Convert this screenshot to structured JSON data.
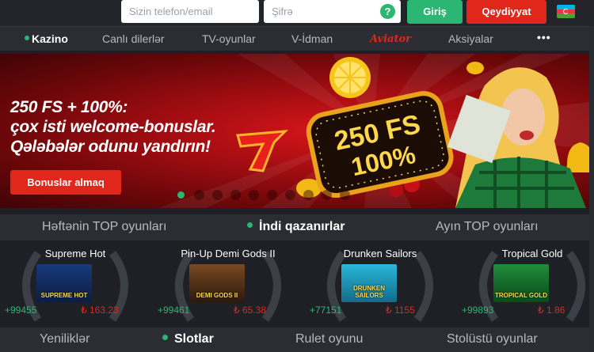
{
  "auth": {
    "phone_placeholder": "Sizin telefon/email",
    "password_placeholder": "Şifrə",
    "help_label": "?",
    "login_label": "Giriş",
    "register_label": "Qeydiyyat",
    "language_flag": "az-flag"
  },
  "nav": {
    "items": [
      {
        "label": "Kazino",
        "active": true
      },
      {
        "label": "Canlı dilerlər"
      },
      {
        "label": "TV-oyunlar"
      },
      {
        "label": "V-İdman"
      },
      {
        "label": "Aviator"
      },
      {
        "label": "Aksiyalar"
      },
      {
        "label": "•••"
      }
    ]
  },
  "banner": {
    "line1": "250 FS + 100%:",
    "line2": "çox isti welcome-bonuslar.",
    "line3": "Qələbələr odunu yandırın!",
    "cta": "Bonuslar almaq",
    "sign_line1": "250 FS",
    "sign_line2": "100%",
    "slides": 10,
    "active_slide": 1
  },
  "winner_tabs": [
    {
      "label": "Həftənin TOP oyunları"
    },
    {
      "label": "İndi qazanırlar",
      "active": true
    },
    {
      "label": "Ayın TOP oyunları"
    }
  ],
  "winners": [
    {
      "game": "Supreme Hot",
      "green": "+99455",
      "red": "₺ 163.23",
      "thumb_label": "SUPREME HOT"
    },
    {
      "game": "Pin-Up Demi Gods II",
      "green": "+99461",
      "red": "₺ 65.38",
      "thumb_label": "DEMI GODS II"
    },
    {
      "game": "Drunken Sailors",
      "green": "+77151",
      "red": "₺ 1155",
      "thumb_label": "DRUNKEN SAILORS"
    },
    {
      "game": "Tropical Gold",
      "green": "+99893",
      "red": "₺ 1.86",
      "thumb_label": "TROPICAL GOLD"
    }
  ],
  "category_tabs": [
    {
      "label": "Yeniliklər"
    },
    {
      "label": "Slotlar",
      "active": true
    },
    {
      "label": "Rulet oyunu"
    },
    {
      "label": "Stolüstü oyunlar"
    }
  ],
  "colors": {
    "accent_green": "#2bb673",
    "accent_red": "#e1261c",
    "bg_dark": "#1e1f24",
    "bar": "#2c2d33"
  }
}
